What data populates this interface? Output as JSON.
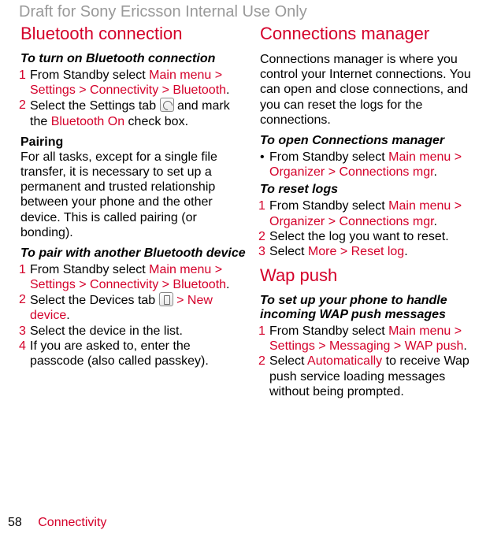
{
  "watermark": "Draft for Sony Ericsson Internal Use Only",
  "left": {
    "title": "Bluetooth connection",
    "turnon_heading": "To turn on Bluetooth connection",
    "turnon_steps": [
      {
        "num": "1",
        "pre": "From Standby select ",
        "link": "Main menu > Settings > Connectivity > Bluetooth",
        "post": "."
      },
      {
        "num": "2",
        "pre": "Select the Settings tab ",
        "icon": "wrench",
        "mid": " and mark the ",
        "link": "Bluetooth On",
        "post": " check box."
      }
    ],
    "pairing_title": "Pairing",
    "pairing_text": "For all tasks, except for a single file transfer, it is necessary to set up a permanent and trusted relationship between your phone and the other device. This is called pairing (or bonding).",
    "pair_heading": "To pair with another Bluetooth device",
    "pair_steps": [
      {
        "num": "1",
        "pre": "From Standby select ",
        "link": "Main menu > Settings > Connectivity > Bluetooth",
        "post": "."
      },
      {
        "num": "2",
        "pre": "Select the Devices tab ",
        "icon": "phone",
        "mid": " ",
        "link": "> New device",
        "post": "."
      },
      {
        "num": "3",
        "pre": "Select the device in the list.",
        "link": "",
        "post": ""
      },
      {
        "num": "4",
        "pre": "If you are asked to, enter the passcode (also called passkey).",
        "link": "",
        "post": ""
      }
    ]
  },
  "right": {
    "cm_title": "Connections manager",
    "cm_intro": "Connections manager is where you control your Internet connections. You can open and close connections, and you can reset the logs for the connections.",
    "cm_open_heading": "To open Connections manager",
    "cm_open_bullet": {
      "pre": "From Standby select ",
      "link": "Main menu > Organizer > Connections mgr",
      "post": "."
    },
    "cm_reset_heading": "To reset logs",
    "cm_reset_steps": [
      {
        "num": "1",
        "pre": "From Standby select ",
        "link": "Main menu > Organizer > Connections mgr",
        "post": "."
      },
      {
        "num": "2",
        "pre": "Select the log you want to reset.",
        "link": "",
        "post": ""
      },
      {
        "num": "3",
        "pre": "Select ",
        "link": "More > Reset log",
        "post": "."
      }
    ],
    "wap_title": "Wap push",
    "wap_heading": "To set up your phone to handle incoming WAP push messages",
    "wap_steps": [
      {
        "num": "1",
        "pre": "From Standby select ",
        "link": "Main menu > Settings > Messaging > WAP push",
        "post": "."
      },
      {
        "num": "2",
        "pre": "Select ",
        "link": "Automatically",
        "post": " to receive Wap push service loading messages without being prompted."
      }
    ]
  },
  "footer": {
    "page": "58",
    "chapter": "Connectivity"
  }
}
